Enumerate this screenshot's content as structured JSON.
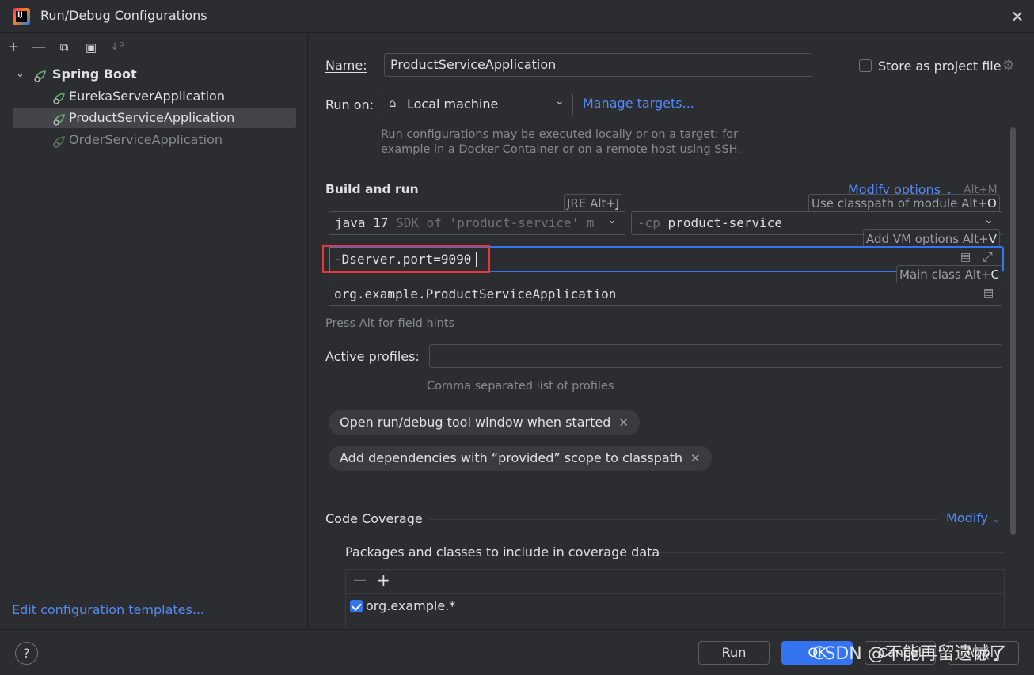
{
  "window": {
    "title": "Run/Debug Configurations"
  },
  "toolbar": {
    "add": "+",
    "remove": "—",
    "copy": "⧉",
    "folder": "▣",
    "sort": "↓ª"
  },
  "tree": {
    "group_label": "Spring Boot",
    "items": [
      {
        "label": "EurekaServerApplication"
      },
      {
        "label": "ProductServiceApplication"
      },
      {
        "label": "OrderServiceApplication"
      }
    ]
  },
  "edit_templates_link": "Edit configuration templates...",
  "config": {
    "name_label": "Name:",
    "name_value": "ProductServiceApplication",
    "store_label": "Store as project file",
    "run_on_label": "Run on:",
    "run_on_value": "Local machine",
    "manage_targets": "Manage targets...",
    "run_on_hint_1": "Run configurations may be executed locally or on a target: for",
    "run_on_hint_2": "example in a Docker Container or on a remote host using SSH.",
    "build_run_title": "Build and run",
    "modify_options": "Modify options",
    "modify_shortcut": "Alt+M",
    "jre_tooltip": "JRE Alt+",
    "jre_key": "J",
    "classpath_tooltip": "Use classpath of module Alt+",
    "classpath_key": "O",
    "vm_tooltip": "Add VM options Alt+",
    "vm_key": "V",
    "main_tooltip": "Main class Alt+",
    "main_key": "C",
    "jdk_main": "java 17",
    "jdk_hint": "SDK of 'product-service' m",
    "cp_prefix": "-cp",
    "cp_value": "product-service",
    "vm_options": "-Dserver.port=9090",
    "main_class": "org.example.ProductServiceApplication",
    "field_hints": "Press Alt for field hints",
    "profiles_label": "Active profiles:",
    "profiles_hint": "Comma separated list of profiles",
    "chip_1": "Open run/debug tool window when started",
    "chip_2": "Add dependencies with “provided” scope to classpath",
    "coverage_title": "Code Coverage",
    "coverage_modify": "Modify",
    "coverage_subtitle": "Packages and classes to include in coverage data",
    "coverage_item": "org.example.*"
  },
  "footer": {
    "help": "?",
    "run": "Run",
    "ok": "OK",
    "cancel": "Cancel",
    "apply": "Apply",
    "watermark": "CSDN @不能再留遗憾了"
  },
  "colors": {
    "accent": "#3574f0",
    "link": "#548af7",
    "highlight_box": "#e5383b",
    "spring_green": "#6aab73"
  }
}
